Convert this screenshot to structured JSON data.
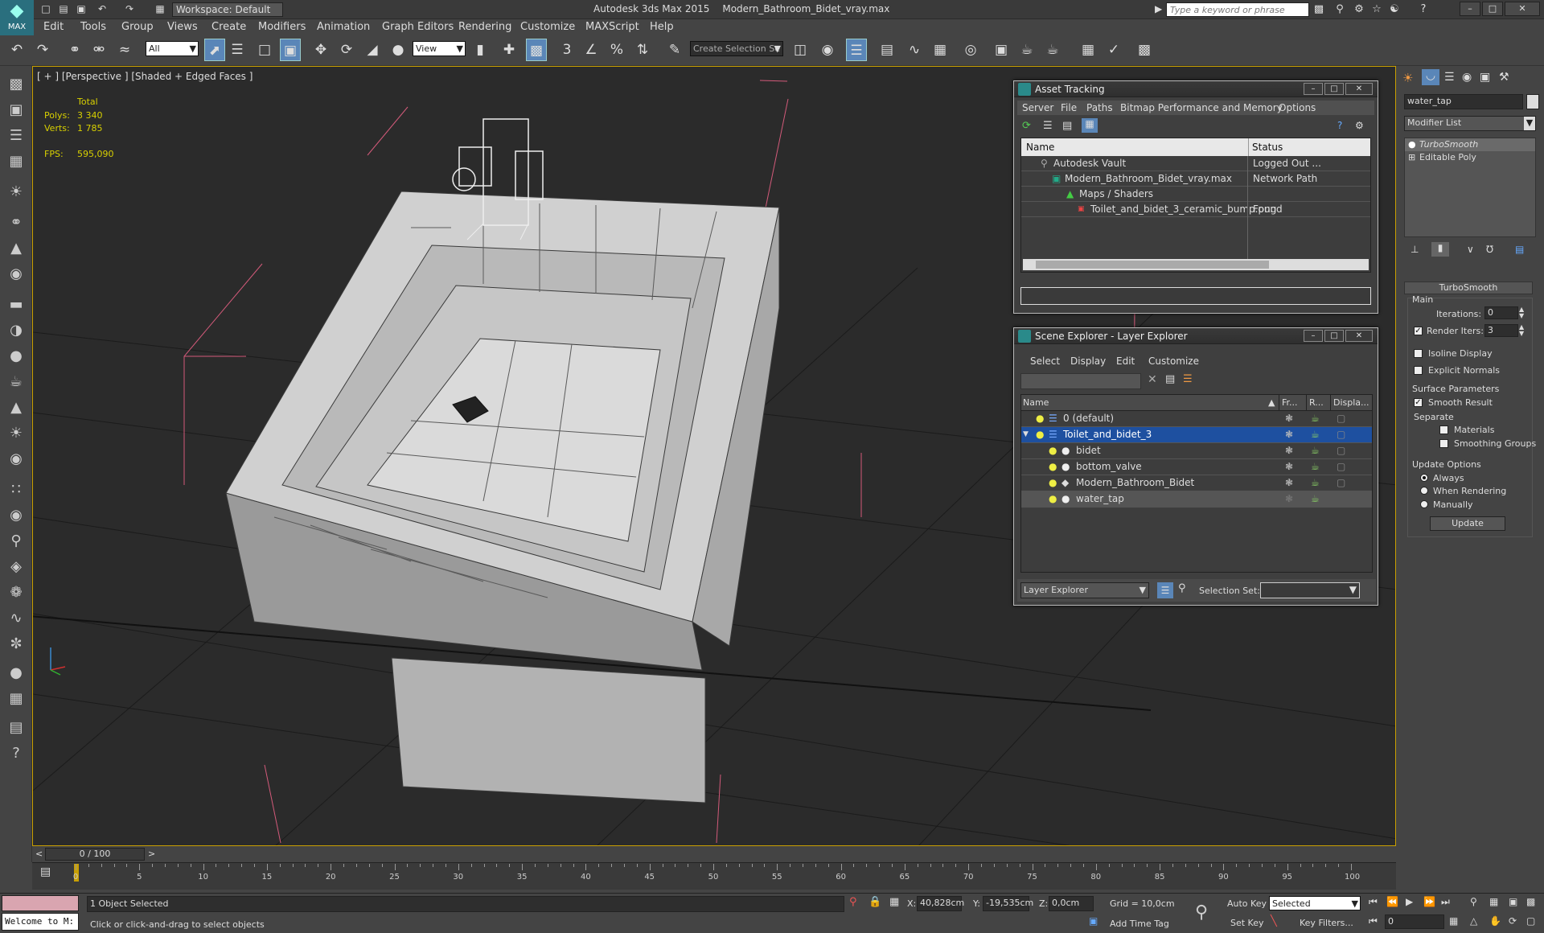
{
  "titlebar": {
    "app": "Autodesk 3ds Max 2015",
    "file": "Modern_Bathroom_Bidet_vray.max",
    "workspace": "Workspace: Default",
    "search_placeholder": "Type a keyword or phrase",
    "logo": "MAX"
  },
  "menu": [
    "Edit",
    "Tools",
    "Group",
    "Views",
    "Create",
    "Modifiers",
    "Animation",
    "Graph Editors",
    "Rendering",
    "Customize",
    "MAXScript",
    "Help"
  ],
  "toolbar": {
    "filter": "All",
    "refcoord": "View",
    "selection_set": "Create Selection Se"
  },
  "viewport": {
    "label": "[ + ] [Perspective ] [Shaded + Edged Faces ]",
    "stats": {
      "total_label": "Total",
      "polys_label": "Polys:",
      "polys": "3 340",
      "verts_label": "Verts:",
      "verts": "1 785",
      "fps_label": "FPS:",
      "fps": "595,090"
    }
  },
  "asset_tracking": {
    "title": "Asset Tracking",
    "menu": [
      "Server",
      "File",
      "Paths",
      "Bitmap Performance and Memory",
      "Options"
    ],
    "col_name": "Name",
    "col_status": "Status",
    "rows": [
      {
        "name": "Autodesk Vault",
        "status": "Logged Out ..."
      },
      {
        "name": "Modern_Bathroom_Bidet_vray.max",
        "status": "Network Path"
      },
      {
        "name": "Maps / Shaders",
        "status": ""
      },
      {
        "name": "Toilet_and_bidet_3_ceramic_bump.png",
        "status": "Found"
      }
    ]
  },
  "scene_explorer": {
    "title": "Scene Explorer - Layer Explorer",
    "menu": [
      "Select",
      "Display",
      "Edit",
      "Customize"
    ],
    "col_name": "Name",
    "col_fr": "Fr...",
    "col_r": "R...",
    "col_disp": "Displa...",
    "rows": [
      {
        "name": "0 (default)"
      },
      {
        "name": "Toilet_and_bidet_3"
      },
      {
        "name": "bidet"
      },
      {
        "name": "bottom_valve"
      },
      {
        "name": "Modern_Bathroom_Bidet"
      },
      {
        "name": "water_tap"
      }
    ],
    "footer_mode": "Layer Explorer",
    "selection_set_label": "Selection Set:"
  },
  "command_panel": {
    "object_name": "water_tap",
    "modifier_list": "Modifier List",
    "stack": [
      "TurboSmooth",
      "Editable Poly"
    ],
    "rollout": "TurboSmooth",
    "main": "Main",
    "iterations_label": "Iterations:",
    "iterations": "0",
    "render_iters_label": "Render Iters:",
    "render_iters": "3",
    "isoline": "Isoline Display",
    "explicit": "Explicit Normals",
    "surface": "Surface Parameters",
    "smooth_result": "Smooth Result",
    "separate": "Separate",
    "materials": "Materials",
    "smoothing_groups": "Smoothing Groups",
    "update_options": "Update Options",
    "always": "Always",
    "when_rendering": "When Rendering",
    "manually": "Manually",
    "update": "Update"
  },
  "timeline": {
    "frame": "0 / 100",
    "ticks": [
      "0",
      "5",
      "10",
      "15",
      "20",
      "25",
      "30",
      "35",
      "40",
      "45",
      "50",
      "55",
      "60",
      "65",
      "70",
      "75",
      "80",
      "85",
      "90",
      "95",
      "100"
    ]
  },
  "status": {
    "selected": "1 Object Selected",
    "hint": "Click or click-and-drag to select objects",
    "welcome": "Welcome to M:",
    "x_label": "X:",
    "x": "40,828cm",
    "y_label": "Y:",
    "y": "-19,535cm",
    "z_label": "Z:",
    "z": "0,0cm",
    "grid": "Grid = 10,0cm",
    "add_time_tag": "Add Time Tag",
    "auto_key": "Auto Key",
    "set_key": "Set Key",
    "selected_dd": "Selected",
    "key_filters": "Key Filters...",
    "frame": "0"
  }
}
